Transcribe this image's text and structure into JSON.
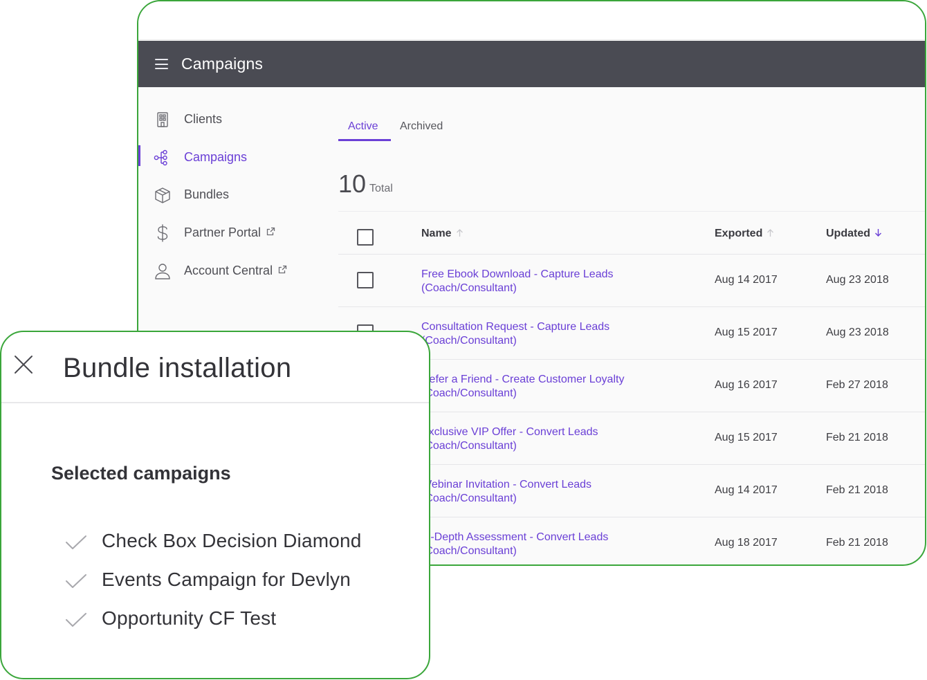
{
  "header": {
    "title": "Campaigns"
  },
  "sidebar": {
    "items": [
      {
        "label": "Clients",
        "icon": "building-icon",
        "active": false,
        "external": false
      },
      {
        "label": "Campaigns",
        "icon": "campaign-flow-icon",
        "active": true,
        "external": false
      },
      {
        "label": "Bundles",
        "icon": "box-icon",
        "active": false,
        "external": false
      },
      {
        "label": "Partner Portal",
        "icon": "dollar-icon",
        "active": false,
        "external": true
      },
      {
        "label": "Account Central",
        "icon": "user-icon",
        "active": false,
        "external": true
      }
    ]
  },
  "tabs": [
    {
      "label": "Active",
      "active": true
    },
    {
      "label": "Archived",
      "active": false
    }
  ],
  "summary": {
    "count": "10",
    "label": "Total"
  },
  "table": {
    "columns": [
      {
        "label": "Name",
        "sort": "asc-inactive"
      },
      {
        "label": "Exported",
        "sort": "asc-inactive"
      },
      {
        "label": "Updated",
        "sort": "desc-active"
      }
    ],
    "rows": [
      {
        "name": "Free Ebook Download - Capture Leads (Coach/Consultant)",
        "exported": "Aug 14 2017",
        "updated": "Aug 23 2018"
      },
      {
        "name": "Consultation Request - Capture Leads (Coach/Consultant)",
        "exported": "Aug 15 2017",
        "updated": "Aug 23 2018"
      },
      {
        "name": "Refer a Friend - Create Customer Loyalty (Coach/Consultant)",
        "exported": "Aug 16 2017",
        "updated": "Feb 27 2018"
      },
      {
        "name": "Exclusive VIP Offer - Convert Leads (Coach/Consultant)",
        "exported": "Aug 15 2017",
        "updated": "Feb 21 2018"
      },
      {
        "name": "Webinar Invitation - Convert Leads (Coach/Consultant)",
        "exported": "Aug 14 2017",
        "updated": "Feb 21 2018"
      },
      {
        "name": "In-Depth Assessment - Convert Leads (Coach/Consultant)",
        "exported": "Aug 18 2017",
        "updated": "Feb 21 2018"
      }
    ]
  },
  "modal": {
    "title": "Bundle installation",
    "section_title": "Selected campaigns",
    "campaigns": [
      "Check Box Decision Diamond",
      "Events Campaign for Devlyn",
      "Opportunity CF Test"
    ]
  },
  "colors": {
    "accent": "#6a3fd6",
    "header_bg": "#4a4b53",
    "frame_border": "#3aa63a"
  }
}
